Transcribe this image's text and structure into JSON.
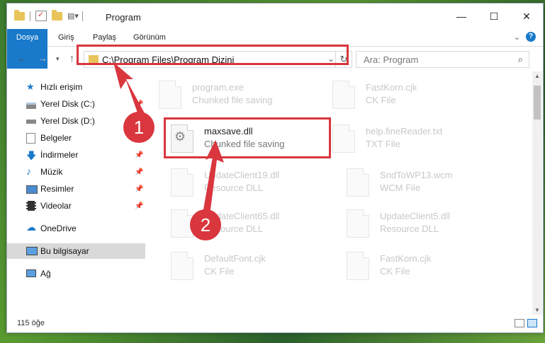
{
  "window": {
    "title": "Program"
  },
  "tabs": [
    "Dosya",
    "Giriş",
    "Paylaş",
    "Görünüm"
  ],
  "address": {
    "path": "C:\\Program Files\\Program Dizini"
  },
  "search": {
    "placeholder": "Ara: Program"
  },
  "sidebar": {
    "items": [
      {
        "label": "Hızlı erişim",
        "icon": "star-icon",
        "pinned": false
      },
      {
        "label": "Yerel Disk (C:)",
        "icon": "drive-icon",
        "pinned": true
      },
      {
        "label": "Yerel Disk (D:)",
        "icon": "drive-icon",
        "pinned": true
      },
      {
        "label": "Belgeler",
        "icon": "documents-icon",
        "pinned": false
      },
      {
        "label": "İndirmeler",
        "icon": "download-icon",
        "pinned": true
      },
      {
        "label": "Müzik",
        "icon": "music-icon",
        "pinned": true
      },
      {
        "label": "Resimler",
        "icon": "pictures-icon",
        "pinned": true
      },
      {
        "label": "Videolar",
        "icon": "video-icon",
        "pinned": true
      },
      {
        "label": "OneDrive",
        "icon": "cloud-icon",
        "pinned": false
      },
      {
        "label": "Bu bilgisayar",
        "icon": "computer-icon",
        "pinned": false,
        "selected": true
      },
      {
        "label": "Ağ",
        "icon": "network-icon",
        "pinned": false
      }
    ]
  },
  "files": [
    {
      "name": "program.exe",
      "type": "Chunked file saving",
      "dim": true
    },
    {
      "name": "FastKorn.cjk",
      "type": "CK File",
      "dim": true
    },
    {
      "name": "maxsave.dll",
      "type": "Chunked file saving",
      "dim": false
    },
    {
      "name": "help.fineReader.txt",
      "type": "TXT File",
      "dim": true
    },
    {
      "name": "UpdateClient19.dll",
      "type": "Resource DLL",
      "dim": true
    },
    {
      "name": "SndToWP13.wcm",
      "type": "WCM File",
      "dim": true
    },
    {
      "name": "UpdateClient65.dll",
      "type": "Resource DLL",
      "dim": true
    },
    {
      "name": "UpdateClient5.dll",
      "type": "Resource DLL",
      "dim": true
    },
    {
      "name": "DefaultFont.cjk",
      "type": "CK File",
      "dim": true
    },
    {
      "name": "FastKorn.cjk",
      "type": "CK File",
      "dim": true
    }
  ],
  "status": {
    "count": "115 öğe"
  },
  "annotations": {
    "badge1": "1",
    "badge2": "2"
  },
  "colors": {
    "accent": "#1979ca",
    "highlight": "#d9363e"
  }
}
